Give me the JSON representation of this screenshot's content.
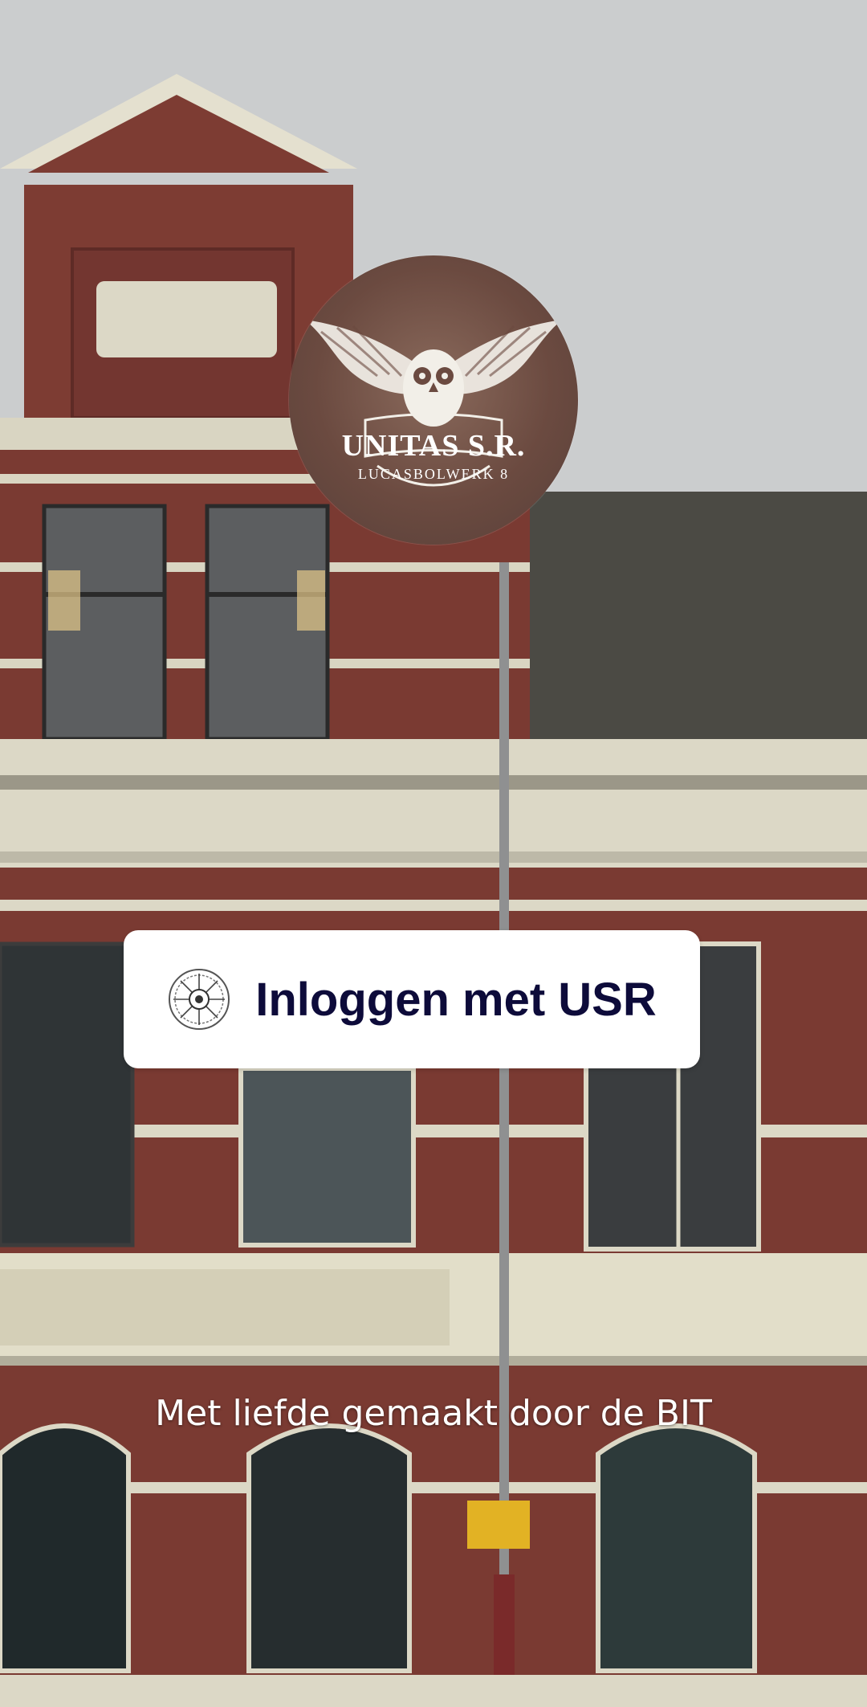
{
  "logo": {
    "title": "UNITAS S.R.",
    "subtitle": "LUCASBOLWERK 8",
    "icon": "owl-wings-emblem"
  },
  "login": {
    "label": "Inloggen met USR",
    "icon": "usr-seal-icon",
    "text_color": "#0d0b3a"
  },
  "footer": {
    "text": "Met liefde gemaakt door de BIT"
  },
  "background": {
    "sky_color": "#c9cccd",
    "brick_color": "#7a3a32",
    "trim_color": "#dcd8c6"
  }
}
